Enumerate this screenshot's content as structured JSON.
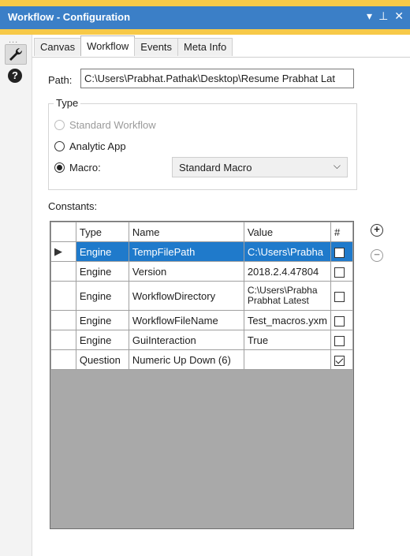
{
  "window": {
    "title": "Workflow - Configuration",
    "ctrl_menu": "▾",
    "ctrl_pin": "⊥",
    "ctrl_close": "✕"
  },
  "sidebar": {
    "dots": "...",
    "wrench_icon": "wrench-icon",
    "help_icon": "help-icon",
    "help_glyph": "?"
  },
  "tabs": [
    {
      "label": "Canvas"
    },
    {
      "label": "Workflow",
      "active": true
    },
    {
      "label": "Events"
    },
    {
      "label": "Meta Info"
    }
  ],
  "path": {
    "label": "Path:",
    "value": "C:\\Users\\Prabhat.Pathak\\Desktop\\Resume Prabhat Lat"
  },
  "type_group": {
    "legend": "Type",
    "options": [
      {
        "label": "Standard Workflow",
        "checked": false,
        "disabled": true
      },
      {
        "label": "Analytic App",
        "checked": false,
        "disabled": false
      },
      {
        "label": "Macro:",
        "checked": true,
        "disabled": false
      }
    ],
    "macro_select": {
      "value": "Standard Macro",
      "arrow": "⌵"
    }
  },
  "constants": {
    "label": "Constants:",
    "headers": [
      "",
      "Type",
      "Name",
      "Value",
      "#"
    ],
    "rows": [
      {
        "indicator": "▶",
        "type": "Engine",
        "name": "TempFilePath",
        "value": "C:\\Users\\Prabha",
        "checked": false,
        "selected": true
      },
      {
        "indicator": "",
        "type": "Engine",
        "name": "Version",
        "value": "2018.2.4.47804",
        "checked": false
      },
      {
        "indicator": "",
        "type": "Engine",
        "name": "WorkflowDirectory",
        "value": "C:\\Users\\Prabha Prabhat Latest",
        "checked": false,
        "tall": true
      },
      {
        "indicator": "",
        "type": "Engine",
        "name": "WorkflowFileName",
        "value": "Test_macros.yxm",
        "checked": false
      },
      {
        "indicator": "",
        "type": "Engine",
        "name": "GuiInteraction",
        "value": "True",
        "checked": false
      },
      {
        "indicator": "",
        "type": "Question",
        "name": "Numeric Up Down (6)",
        "value": "",
        "checked": true
      }
    ],
    "add_glyph": "+",
    "remove_glyph": "−"
  }
}
